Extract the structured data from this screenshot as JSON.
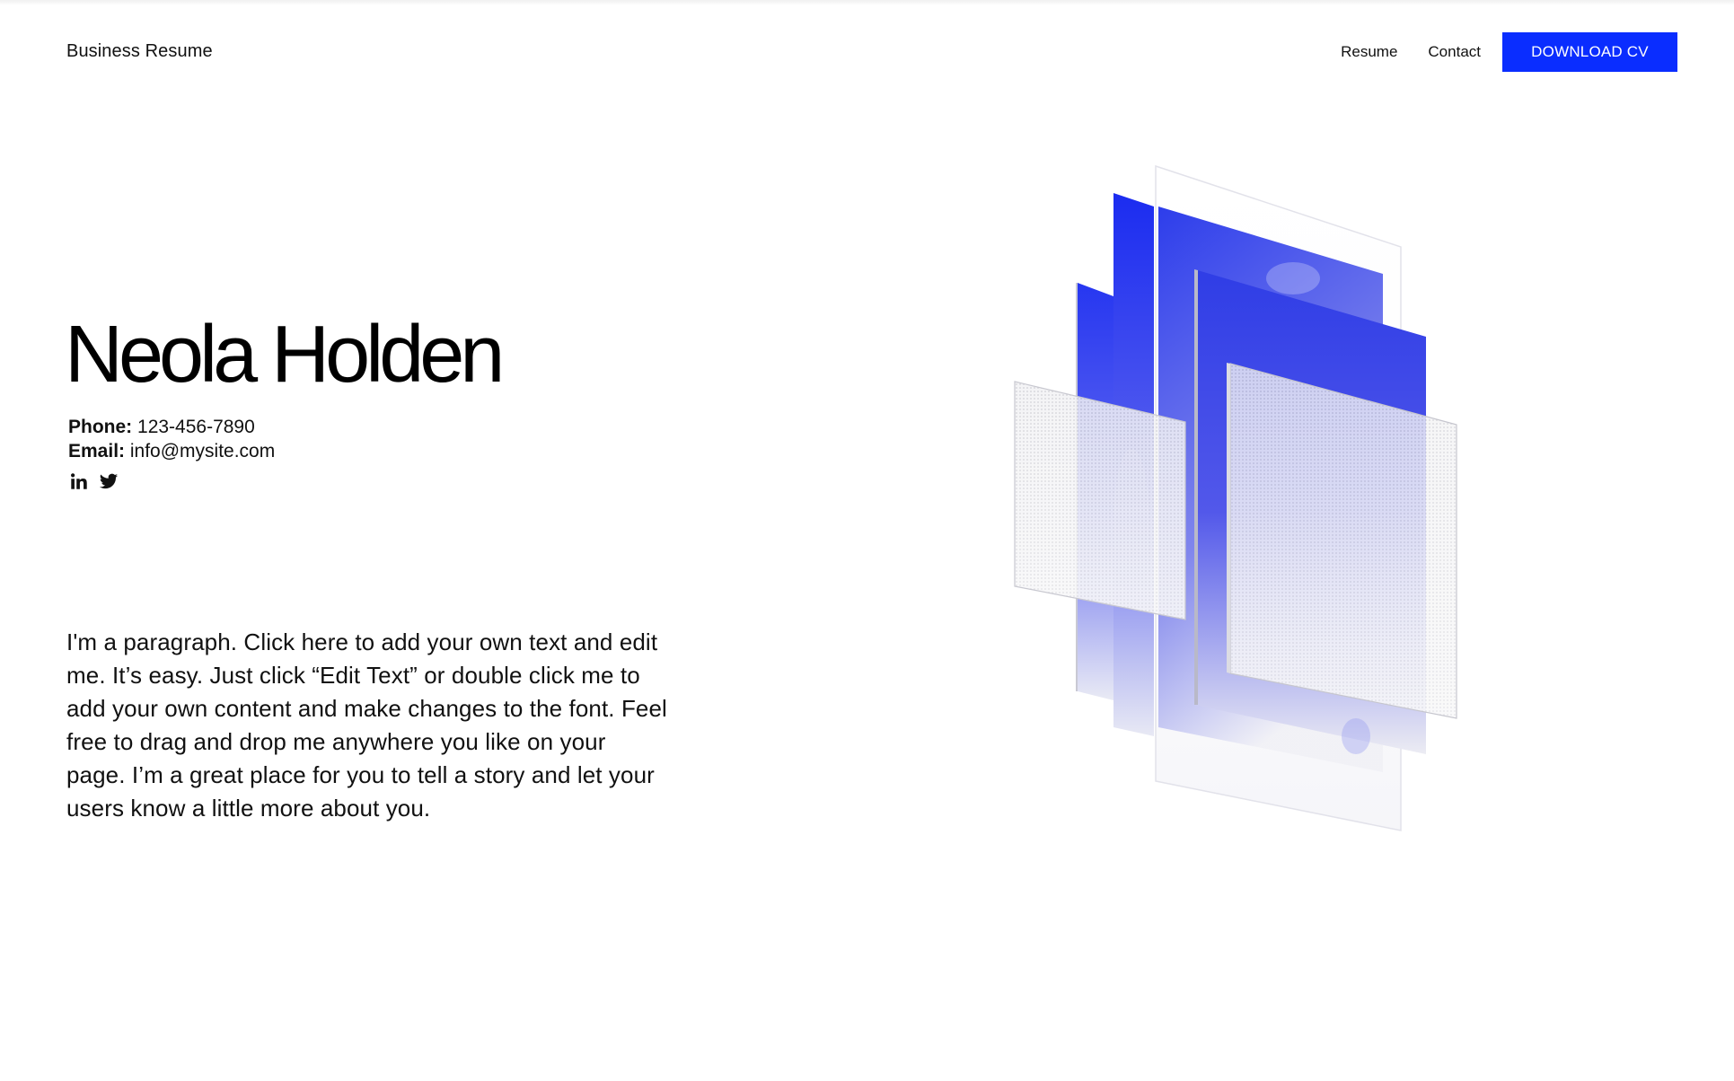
{
  "header": {
    "brand": "Business Resume",
    "nav": [
      {
        "label": "Resume"
      },
      {
        "label": "Contact"
      }
    ],
    "cta_label": "DOWNLOAD CV"
  },
  "hero": {
    "name": "Neola Holden",
    "phone_label": "Phone:",
    "phone_value": "123-456-7890",
    "email_label": "Email:",
    "email_value": "info@mysite.com",
    "socials": [
      {
        "icon": "linkedin-icon"
      },
      {
        "icon": "twitter-icon"
      }
    ]
  },
  "about": {
    "paragraph": "I'm a paragraph. Click here to add your own text and edit me. It’s easy. Just click “Edit Text” or double click me to add your own content and make changes to the font. Feel free to drag and drop me anywhere you like on your page. I’m a great place for you to tell a story and let your users know a little more about you."
  },
  "colors": {
    "accent": "#0a2dff",
    "text": "#111111",
    "background": "#ffffff"
  }
}
